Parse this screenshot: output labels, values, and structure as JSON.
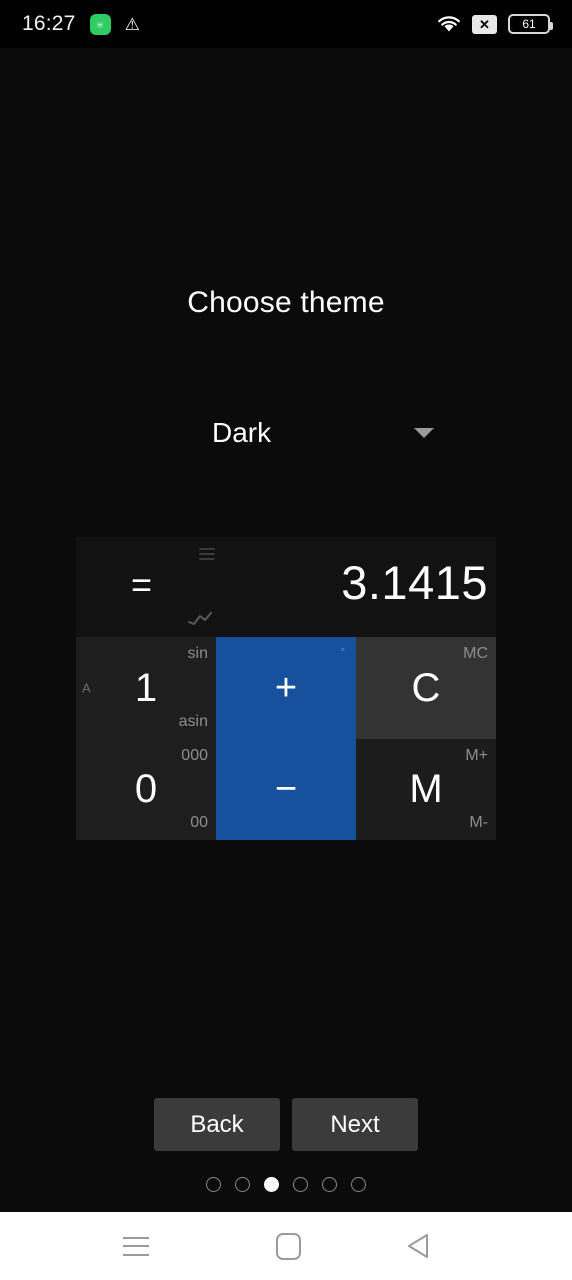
{
  "statusbar": {
    "time": "16:27",
    "app_icon": "app-icon",
    "app_glyph": "♅",
    "warning_icon": "warning-triangle-icon",
    "warning_glyph": "⚠",
    "wifi_icon": "wifi-icon",
    "nosim_icon": "no-sim-icon",
    "nosim_glyph": "✕",
    "battery_level": "61"
  },
  "page": {
    "title": "Choose theme"
  },
  "theme_dropdown": {
    "value": "Dark",
    "caret_icon": "chevron-down-icon",
    "options": [
      "Dark"
    ]
  },
  "preview": {
    "display": {
      "equals": "=",
      "menu_icon": "menu-icon",
      "chart_icon": "chart-trend-icon",
      "value": "3.1415"
    },
    "keys": [
      {
        "name": "key-one",
        "main": "1",
        "top_right": "sin",
        "bottom_right": "asin",
        "left": "A",
        "style": "num"
      },
      {
        "name": "key-plus",
        "main": "+",
        "top_right": "°",
        "bottom_right": "",
        "left": "",
        "style": "op"
      },
      {
        "name": "key-clear",
        "main": "C",
        "top_right": "MC",
        "bottom_right": "",
        "left": "",
        "style": "clr"
      },
      {
        "name": "key-zero",
        "main": "0",
        "top_right": "000",
        "bottom_right": "00",
        "left": "",
        "style": "num"
      },
      {
        "name": "key-minus",
        "main": "−",
        "top_right": "",
        "bottom_right": "",
        "left": "",
        "style": "op"
      },
      {
        "name": "key-memory",
        "main": "M",
        "top_right": "M+",
        "bottom_right": "M-",
        "left": "",
        "style": "mem"
      }
    ]
  },
  "wizard": {
    "back_label": "Back",
    "next_label": "Next",
    "total_pages": 6,
    "current_page": 3
  },
  "sysnav": {
    "recent_icon": "recents-icon",
    "home_icon": "home-icon",
    "back_icon": "back-icon"
  },
  "colors": {
    "background": "#0b0b0b",
    "accent_blue": "#17519e",
    "key_num": "#1e1e1e",
    "key_clear": "#333333",
    "key_memory": "#1c1c1c",
    "button_gray": "#3b3b3b",
    "status_green": "#2ecc63"
  }
}
